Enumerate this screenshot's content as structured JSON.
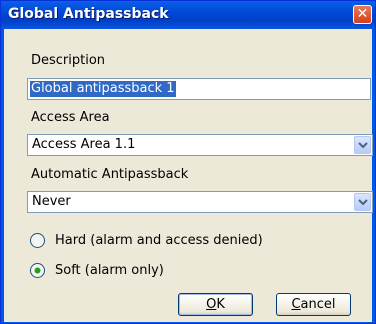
{
  "window": {
    "title": "Global Antipassback",
    "close_glyph": "✕"
  },
  "description": {
    "label": "Description",
    "value": "Global antipassback 1"
  },
  "access_area": {
    "label": "Access Area",
    "value": "Access Area 1.1"
  },
  "auto_antipassback": {
    "label": "Automatic Antipassback",
    "value": "Never"
  },
  "mode": {
    "options": [
      {
        "label": "Hard (alarm and access denied)",
        "checked": false
      },
      {
        "label": "Soft (alarm only)",
        "checked": true
      }
    ]
  },
  "buttons": {
    "ok": {
      "mnemonic": "O",
      "rest": "K"
    },
    "cancel": {
      "mnemonic": "C",
      "rest": "ancel"
    }
  },
  "icons": {
    "dropdown": "chevron-down-icon",
    "close": "close-icon"
  },
  "colors": {
    "title_bar": "#0058e6",
    "selection": "#316ac5",
    "dialog_bg": "#ece9d8"
  }
}
